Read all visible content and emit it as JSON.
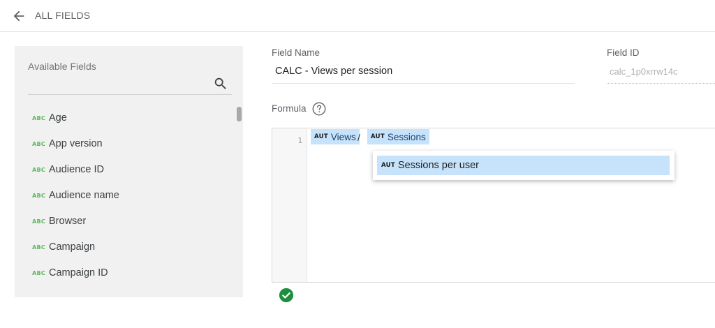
{
  "header": {
    "title": "ALL FIELDS",
    "back_icon": "arrow-back-icon"
  },
  "sidebar": {
    "title": "Available Fields",
    "search_icon": "search-icon",
    "items": [
      {
        "label": "Age",
        "type": "ABC"
      },
      {
        "label": "App version",
        "type": "ABC"
      },
      {
        "label": "Audience ID",
        "type": "ABC"
      },
      {
        "label": "Audience name",
        "type": "ABC"
      },
      {
        "label": "Browser",
        "type": "ABC"
      },
      {
        "label": "Campaign",
        "type": "ABC"
      },
      {
        "label": "Campaign ID",
        "type": "ABC"
      }
    ]
  },
  "form": {
    "field_name_label": "Field Name",
    "field_name_value": "CALC - Views per session",
    "field_id_label": "Field ID",
    "field_id_value": "calc_1p0xrrw14c",
    "formula_label": "Formula",
    "help_icon": "help-icon"
  },
  "editor": {
    "line_number": "1",
    "tokens": [
      {
        "type": "AUT",
        "label": "Views"
      },
      {
        "type": "AUT",
        "label": "Sessions"
      }
    ],
    "operator": "/",
    "suggestion": {
      "type": "AUT",
      "label": "Sessions per user"
    },
    "status_icon": "check-circle-icon"
  },
  "colors": {
    "chip_bg": "#c6e3fb",
    "abc_green": "#5cb85c",
    "valid_green": "#1e8e3e",
    "panel_bg": "#f1f1f1"
  }
}
